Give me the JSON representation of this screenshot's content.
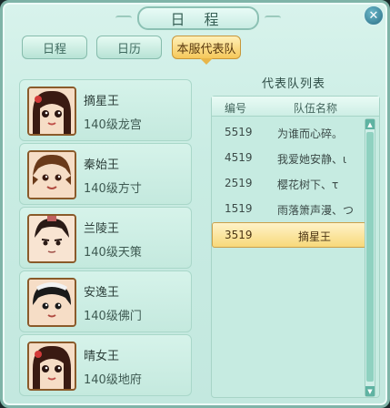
{
  "window": {
    "title": "日 程",
    "close_icon": "close-icon"
  },
  "tabs": [
    {
      "label": "日程",
      "active": false
    },
    {
      "label": "日历",
      "active": false
    },
    {
      "label": "本服代表队",
      "active": true
    }
  ],
  "members": [
    {
      "name": "摘星王",
      "info": "140级龙宫",
      "hair": "#3a1a12",
      "accent": "#d33a3a"
    },
    {
      "name": "秦始王",
      "info": "140级方寸",
      "hair": "#6a3a1a",
      "accent": "#e0b060"
    },
    {
      "name": "兰陵王",
      "info": "140级天策",
      "hair": "#2a1a16",
      "accent": "#c06060"
    },
    {
      "name": "安逸王",
      "info": "140级佛门",
      "hair": "#1a1a1a",
      "accent": "#f2f2f2"
    },
    {
      "name": "晴女王",
      "info": "140级地府",
      "hair": "#3a1a12",
      "accent": "#d33a3a"
    }
  ],
  "team_list": {
    "title": "代表队列表",
    "col_id": "编号",
    "col_name": "队伍名称",
    "rows": [
      {
        "id": "5519",
        "name": "为谁而心碎。",
        "selected": false
      },
      {
        "id": "4519",
        "name": "我爱她安静、ι",
        "selected": false
      },
      {
        "id": "2519",
        "name": "樱花树下、τ",
        "selected": false
      },
      {
        "id": "1519",
        "name": "雨落箫声漫、つ",
        "selected": false
      },
      {
        "id": "3519",
        "name": "摘星王",
        "selected": true
      }
    ]
  },
  "colors": {
    "accent": "#f5c85a",
    "panel": "#c9ece3",
    "border": "#7fb4a8"
  }
}
